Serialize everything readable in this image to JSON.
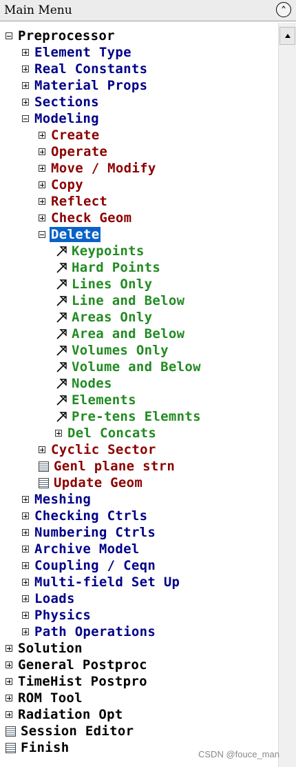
{
  "menu": {
    "title": "Main Menu",
    "items": [
      {
        "label": "Preprocessor",
        "level": 0,
        "icon": "minus-box",
        "color": "#000000"
      },
      {
        "label": "Element Type",
        "level": 1,
        "icon": "plus-box",
        "color": "#000088"
      },
      {
        "label": "Real Constants",
        "level": 1,
        "icon": "plus-box",
        "color": "#000088"
      },
      {
        "label": "Material Props",
        "level": 1,
        "icon": "plus-box",
        "color": "#000088"
      },
      {
        "label": "Sections",
        "level": 1,
        "icon": "plus-box",
        "color": "#000088"
      },
      {
        "label": "Modeling",
        "level": 1,
        "icon": "minus-box",
        "color": "#000088"
      },
      {
        "label": "Create",
        "level": 2,
        "icon": "plus-box",
        "color": "#8b0000"
      },
      {
        "label": "Operate",
        "level": 2,
        "icon": "plus-box",
        "color": "#8b0000"
      },
      {
        "label": "Move / Modify",
        "level": 2,
        "icon": "plus-box",
        "color": "#8b0000"
      },
      {
        "label": "Copy",
        "level": 2,
        "icon": "plus-box",
        "color": "#8b0000"
      },
      {
        "label": "Reflect",
        "level": 2,
        "icon": "plus-box",
        "color": "#8b0000"
      },
      {
        "label": "Check Geom",
        "level": 2,
        "icon": "plus-box",
        "color": "#8b0000"
      },
      {
        "label": "Delete",
        "level": 2,
        "icon": "minus-box",
        "color": "#8b0000",
        "selected": true
      },
      {
        "label": "Keypoints",
        "level": 3,
        "icon": "action-arrow",
        "color": "#228b22"
      },
      {
        "label": "Hard Points",
        "level": 3,
        "icon": "action-arrow",
        "color": "#228b22"
      },
      {
        "label": "Lines Only",
        "level": 3,
        "icon": "action-arrow",
        "color": "#228b22"
      },
      {
        "label": "Line and Below",
        "level": 3,
        "icon": "action-arrow",
        "color": "#228b22"
      },
      {
        "label": "Areas Only",
        "level": 3,
        "icon": "action-arrow",
        "color": "#228b22"
      },
      {
        "label": "Area and Below",
        "level": 3,
        "icon": "action-arrow",
        "color": "#228b22"
      },
      {
        "label": "Volumes Only",
        "level": 3,
        "icon": "action-arrow",
        "color": "#228b22"
      },
      {
        "label": "Volume and Below",
        "level": 3,
        "icon": "action-arrow",
        "color": "#228b22"
      },
      {
        "label": "Nodes",
        "level": 3,
        "icon": "action-arrow",
        "color": "#228b22"
      },
      {
        "label": "Elements",
        "level": 3,
        "icon": "action-arrow",
        "color": "#228b22"
      },
      {
        "label": "Pre-tens Elemnts",
        "level": 3,
        "icon": "action-arrow",
        "color": "#228b22"
      },
      {
        "label": "Del Concats",
        "level": 3,
        "icon": "plus-box",
        "color": "#228b22"
      },
      {
        "label": "Cyclic Sector",
        "level": 2,
        "icon": "plus-box",
        "color": "#8b0000"
      },
      {
        "label": "Genl plane strn",
        "level": 2,
        "icon": "dialog-icon",
        "color": "#8b0000"
      },
      {
        "label": "Update Geom",
        "level": 2,
        "icon": "dialog-icon",
        "color": "#8b0000"
      },
      {
        "label": "Meshing",
        "level": 1,
        "icon": "plus-box",
        "color": "#000088"
      },
      {
        "label": "Checking Ctrls",
        "level": 1,
        "icon": "plus-box",
        "color": "#000088"
      },
      {
        "label": "Numbering Ctrls",
        "level": 1,
        "icon": "plus-box",
        "color": "#000088"
      },
      {
        "label": "Archive Model",
        "level": 1,
        "icon": "plus-box",
        "color": "#000088"
      },
      {
        "label": "Coupling / Ceqn",
        "level": 1,
        "icon": "plus-box",
        "color": "#000088"
      },
      {
        "label": "Multi-field Set Up",
        "level": 1,
        "icon": "plus-box",
        "color": "#000088"
      },
      {
        "label": "Loads",
        "level": 1,
        "icon": "plus-box",
        "color": "#000088"
      },
      {
        "label": "Physics",
        "level": 1,
        "icon": "plus-box",
        "color": "#000088"
      },
      {
        "label": "Path Operations",
        "level": 1,
        "icon": "plus-box",
        "color": "#000088"
      },
      {
        "label": "Solution",
        "level": 0,
        "icon": "plus-box",
        "color": "#000000"
      },
      {
        "label": "General Postproc",
        "level": 0,
        "icon": "plus-box",
        "color": "#000000"
      },
      {
        "label": "TimeHist Postpro",
        "level": 0,
        "icon": "plus-box",
        "color": "#000000"
      },
      {
        "label": "ROM Tool",
        "level": 0,
        "icon": "plus-box",
        "color": "#000000"
      },
      {
        "label": "Radiation Opt",
        "level": 0,
        "icon": "plus-box",
        "color": "#000000"
      },
      {
        "label": "Session Editor",
        "level": 0,
        "icon": "dialog-icon",
        "color": "#000000"
      },
      {
        "label": "Finish",
        "level": 0,
        "icon": "dialog-icon",
        "color": "#000000"
      }
    ]
  },
  "colors": {
    "selection_bg": "#0a62c8",
    "selection_fg": "#ffffff"
  },
  "watermark": "CSDN @fouce_man"
}
